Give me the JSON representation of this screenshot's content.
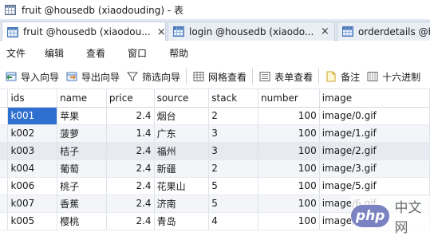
{
  "window": {
    "title": "fruit @housedb (xiaodouding) - 表"
  },
  "tabs": [
    {
      "label": "fruit @housedb (xiaodou...",
      "close": "×",
      "active": true
    },
    {
      "label": "login @housedb (xiaodo...",
      "close": "×",
      "active": false
    },
    {
      "label": "orderdetails @h",
      "active": false
    }
  ],
  "menu": [
    "文件",
    "编辑",
    "查看",
    "窗口",
    "帮助"
  ],
  "toolbar": {
    "import_wizard": "导入向导",
    "export_wizard": "导出向导",
    "filter_wizard": "筛选向导",
    "grid_view": "网格查看",
    "form_view": "表单查看",
    "memo": "备注",
    "hex": "十六进制"
  },
  "table": {
    "columns": [
      "ids",
      "name",
      "price",
      "source",
      "stack",
      "number",
      "image"
    ],
    "rows": [
      {
        "ids": "k001",
        "name": "苹果",
        "price": "2.4",
        "source": "烟台",
        "stack": "2",
        "number": "100",
        "image": "image/0.gif"
      },
      {
        "ids": "k002",
        "name": "菠萝",
        "price": "1.4",
        "source": "广东",
        "stack": "3",
        "number": "100",
        "image": "image/1.gif"
      },
      {
        "ids": "k003",
        "name": "桔子",
        "price": "2.4",
        "source": "福州",
        "stack": "3",
        "number": "100",
        "image": "image/2.gif"
      },
      {
        "ids": "k004",
        "name": "葡萄",
        "price": "2.4",
        "source": "新疆",
        "stack": "2",
        "number": "100",
        "image": "image/3.gif"
      },
      {
        "ids": "k006",
        "name": "桃子",
        "price": "2.4",
        "source": "花果山",
        "stack": "5",
        "number": "100",
        "image": "image/5.gif"
      },
      {
        "ids": "k007",
        "name": "香蕉",
        "price": "2.4",
        "source": "济南",
        "stack": "5",
        "number": "100",
        "image": "image/6.gif"
      },
      {
        "ids": "k005",
        "name": "樱桃",
        "price": "2.4",
        "source": "青岛",
        "stack": "4",
        "number": "100",
        "image": "image/4.gif"
      }
    ],
    "selected_row": 0,
    "highlighted_row": 2
  },
  "watermark": {
    "logo": "php",
    "text": "中文网"
  }
}
